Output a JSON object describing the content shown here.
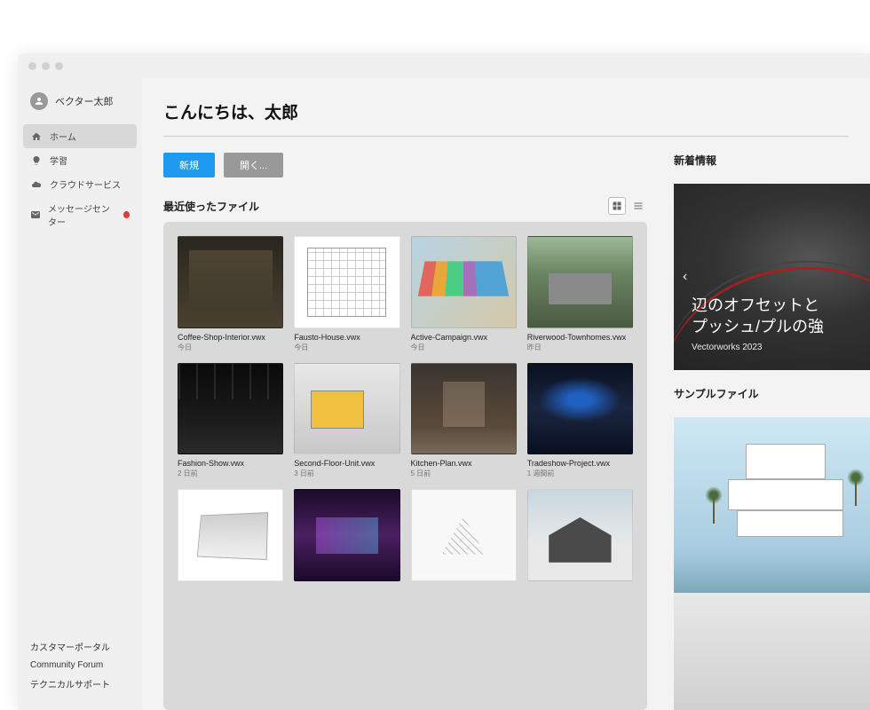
{
  "user": {
    "name": "ベクター太郎"
  },
  "sidebar": {
    "items": [
      {
        "label": "ホーム",
        "icon": "home",
        "active": true
      },
      {
        "label": "学習",
        "icon": "bulb"
      },
      {
        "label": "クラウドサービス",
        "icon": "cloud"
      },
      {
        "label": "メッセージセンター",
        "icon": "mail",
        "badge": true
      }
    ],
    "footer": [
      "カスタマーポータル",
      "Community Forum",
      "テクニカルサポート"
    ]
  },
  "greeting": "こんにちは、太郎",
  "actions": {
    "new": "新規",
    "open": "開く..."
  },
  "recent": {
    "title": "最近使ったファイル",
    "files": [
      {
        "name": "Coffee-Shop-Interior.vwx",
        "date": "今日",
        "thumb": "interior"
      },
      {
        "name": "Fausto-House.vwx",
        "date": "今日",
        "thumb": "plan"
      },
      {
        "name": "Active-Campaign.vwx",
        "date": "今日",
        "thumb": "campaign"
      },
      {
        "name": "Riverwood-Townhomes.vwx",
        "date": "昨日",
        "thumb": "landscape"
      },
      {
        "name": "Fashion-Show.vwx",
        "date": "2 日前",
        "thumb": "fashion"
      },
      {
        "name": "Second-Floor-Unit.vwx",
        "date": "3 日前",
        "thumb": "floor"
      },
      {
        "name": "Kitchen-Plan.vwx",
        "date": "5 日前",
        "thumb": "kitchen"
      },
      {
        "name": "Tradeshow-Project.vwx",
        "date": "1 週間前",
        "thumb": "tradeshow"
      },
      {
        "name": "",
        "date": "",
        "thumb": "greyhound"
      },
      {
        "name": "",
        "date": "",
        "thumb": "vw"
      },
      {
        "name": "",
        "date": "",
        "thumb": "sketch"
      },
      {
        "name": "",
        "date": "",
        "thumb": "house"
      }
    ]
  },
  "news": {
    "section": "新着情報",
    "title": "辺のオフセットと\nプッシュ/プルの強",
    "subtitle": "Vectorworks 2023"
  },
  "samples": {
    "section": "サンプルファイル"
  }
}
